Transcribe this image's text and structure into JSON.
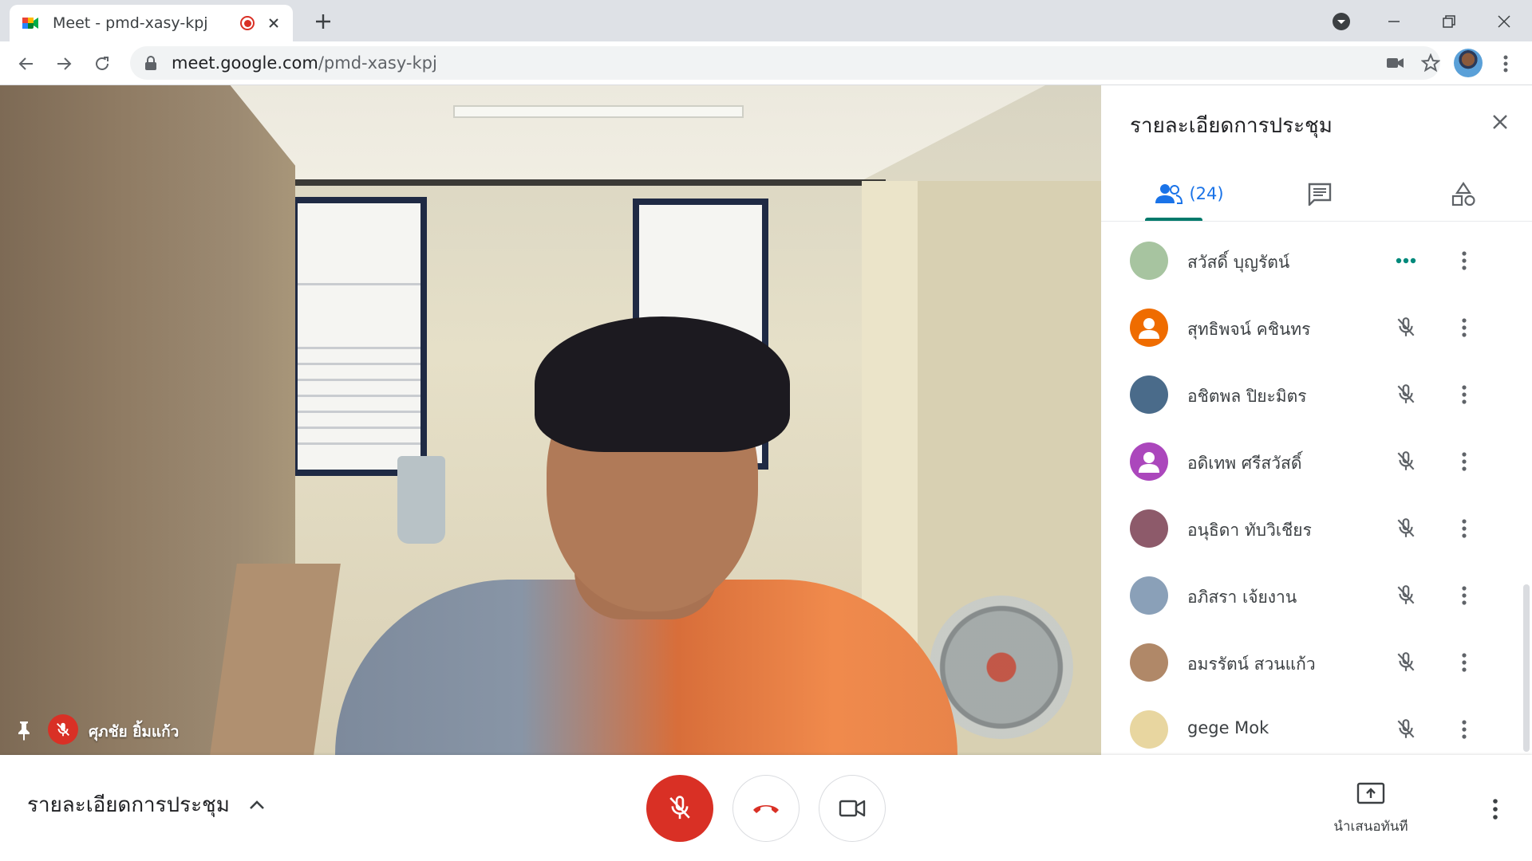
{
  "browser": {
    "tab_title": "Meet - pmd-xasy-kpj",
    "url_domain": "meet.google.com",
    "url_path": "/pmd-xasy-kpj"
  },
  "video": {
    "speaker_name": "ศุภชัย ยิ้มแก้ว"
  },
  "panel": {
    "title": "รายละเอียดการประชุม",
    "people_count": "(24)",
    "participants": [
      {
        "name": "สวัสดิ์ บุญรัตน์",
        "status": "more-activity",
        "avatar_color": "#a7c4a0"
      },
      {
        "name": "สุทธิพจน์ คชินทร",
        "status": "muted",
        "avatar_color": "#ef6c00"
      },
      {
        "name": "อชิตพล ปิยะมิตร",
        "status": "muted",
        "avatar_color": "#4a6b8a"
      },
      {
        "name": "อดิเทพ ศรีสวัสดิ์",
        "status": "muted",
        "avatar_color": "#ab47bc"
      },
      {
        "name": "อนุธิดา ทับวิเชียร",
        "status": "muted",
        "avatar_color": "#8d5a6a"
      },
      {
        "name": "อภิสรา เจ้ยงาน",
        "status": "muted",
        "avatar_color": "#8aa0b8"
      },
      {
        "name": "อมรรัตน์ สวนแก้ว",
        "status": "muted",
        "avatar_color": "#b08868"
      },
      {
        "name": "gege Mok",
        "status": "muted",
        "avatar_color": "#e8d6a0"
      }
    ]
  },
  "bottom": {
    "meeting_details_label": "รายละเอียดการประชุม",
    "present_label": "นำเสนอทันที"
  },
  "colors": {
    "accent_teal": "#00796b",
    "danger_red": "#d93025",
    "link_blue": "#1a73e8"
  }
}
